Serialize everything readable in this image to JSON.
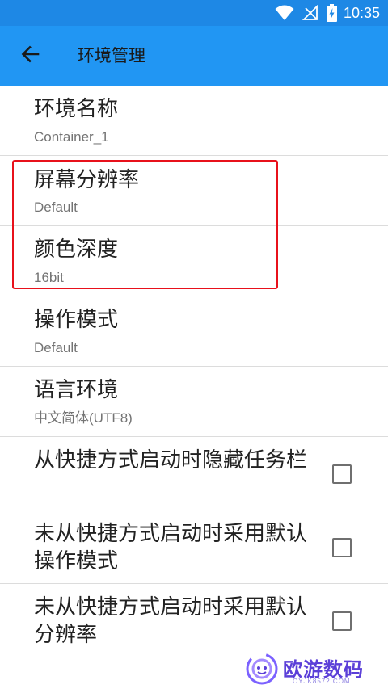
{
  "status_bar": {
    "time": "10:35",
    "icons": [
      "wifi-icon",
      "no-signal-icon",
      "battery-charging-icon"
    ]
  },
  "app_bar": {
    "back_icon": "arrow-back-icon",
    "title": "环境管理",
    "color": "#2196f3"
  },
  "settings": [
    {
      "title": "环境名称",
      "value": "Container_1"
    },
    {
      "title": "屏幕分辨率",
      "value": "Default"
    },
    {
      "title": "颜色深度",
      "value": "16bit"
    },
    {
      "title": "操作模式",
      "value": "Default"
    },
    {
      "title": "语言环境",
      "value": "中文简体(UTF8)"
    }
  ],
  "checkbox_settings": [
    {
      "title": "从快捷方式启动时隐藏任务栏",
      "checked": false
    },
    {
      "title": "未从快捷方式启动时采用默认操作模式",
      "checked": false
    },
    {
      "title": "未从快捷方式启动时采用默认分辨率",
      "checked": false
    }
  ],
  "highlight": {
    "color": "#e8111b",
    "covers": [
      "屏幕分辨率",
      "颜色深度"
    ]
  },
  "watermark": {
    "text": "欧游数码",
    "sub": "OYJK8572.COM",
    "color": "#5b3fd8"
  }
}
